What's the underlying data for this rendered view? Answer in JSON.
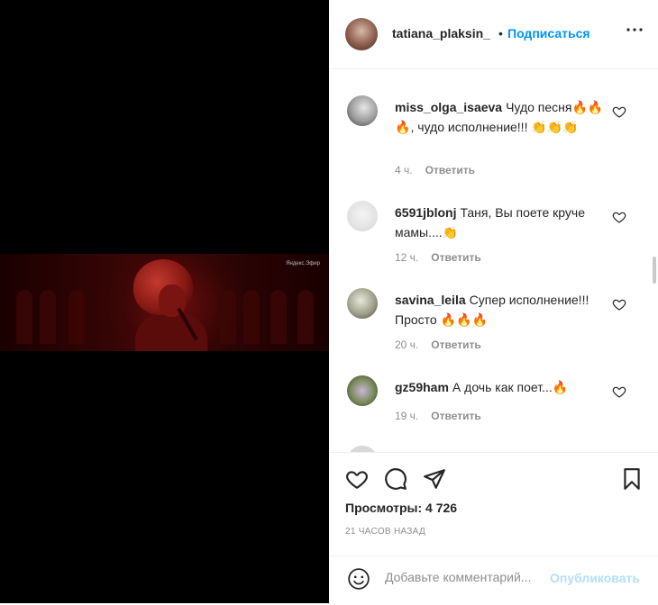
{
  "post": {
    "username": "tatiana_plaksin_",
    "separator": "•",
    "follow_label": "Подписаться",
    "more_icon": "more-horizontal-icon",
    "media_watermark": "Яндекс.Эфир"
  },
  "comments": [
    {
      "username": "miss_olga_isaeva",
      "text_parts": [
        "Чудо песня",
        "🔥🔥🔥",
        ", чудо исполнение!!! ",
        "👏👏👏"
      ],
      "time": "4 ч.",
      "reply_label": "Ответить"
    },
    {
      "username": "6591jblonj",
      "text_parts": [
        "Таня, Вы поете круче мамы....",
        "👏"
      ],
      "time": "12 ч.",
      "reply_label": "Ответить"
    },
    {
      "username": "savina_leila",
      "text_parts": [
        "Супер исполнение!!!Просто ",
        "🔥🔥🔥"
      ],
      "time": "20 ч.",
      "reply_label": "Ответить"
    },
    {
      "username": "gz59ham",
      "text_parts": [
        "А дочь как поет...",
        "🔥"
      ],
      "time": "19 ч.",
      "reply_label": "Ответить"
    }
  ],
  "actions": {
    "like_icon": "heart-icon",
    "comment_icon": "comment-icon",
    "share_icon": "share-icon",
    "save_icon": "bookmark-icon",
    "views_label": "Просмотры: 4 726",
    "time_ago": "21 ЧАСОВ НАЗАД"
  },
  "add_comment": {
    "placeholder": "Добавьте комментарий...",
    "publish_label": "Опубликовать",
    "emoji_icon": "smiley-icon"
  },
  "colors": {
    "accent": "#0095f6",
    "publish_disabled": "#b2dffc",
    "muted_text": "#8e8e8e",
    "text": "#262626"
  }
}
